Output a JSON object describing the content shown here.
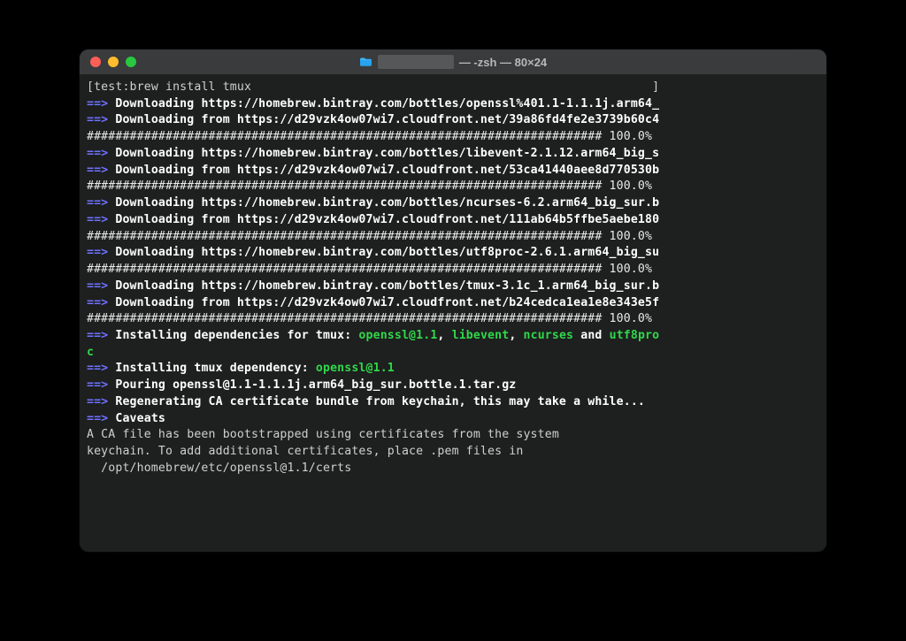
{
  "window": {
    "title_suffix": " — -zsh — 80×24",
    "folder_icon": "folder-icon"
  },
  "traffic": {
    "close": "close",
    "minimize": "minimize",
    "zoom": "zoom"
  },
  "lines": [
    {
      "t": "prompt",
      "open": "[",
      "prompt": "test:",
      "cmd": "brew install tmux",
      "close": "]"
    },
    {
      "t": "arrow_bold",
      "arrow": "==>",
      "rest": " Downloading https://homebrew.bintray.com/bottles/openssl%401.1-1.1.1j.arm64_"
    },
    {
      "t": "arrow_bold",
      "arrow": "==>",
      "rest": " Downloading from https://d29vzk4ow07wi7.cloudfront.net/39a86fd4fe2e3739b60c4"
    },
    {
      "t": "plain",
      "text": "######################################################################## 100.0%"
    },
    {
      "t": "arrow_bold",
      "arrow": "==>",
      "rest": " Downloading https://homebrew.bintray.com/bottles/libevent-2.1.12.arm64_big_s"
    },
    {
      "t": "arrow_bold",
      "arrow": "==>",
      "rest": " Downloading from https://d29vzk4ow07wi7.cloudfront.net/53ca41440aee8d770530b"
    },
    {
      "t": "plain",
      "text": "######################################################################## 100.0%"
    },
    {
      "t": "arrow_bold",
      "arrow": "==>",
      "rest": " Downloading https://homebrew.bintray.com/bottles/ncurses-6.2.arm64_big_sur.b"
    },
    {
      "t": "arrow_bold",
      "arrow": "==>",
      "rest": " Downloading from https://d29vzk4ow07wi7.cloudfront.net/111ab64b5ffbe5aebe180"
    },
    {
      "t": "plain",
      "text": "######################################################################## 100.0%"
    },
    {
      "t": "arrow_bold",
      "arrow": "==>",
      "rest": " Downloading https://homebrew.bintray.com/bottles/utf8proc-2.6.1.arm64_big_su"
    },
    {
      "t": "plain",
      "text": "######################################################################## 100.0%"
    },
    {
      "t": "arrow_bold",
      "arrow": "==>",
      "rest": " Downloading https://homebrew.bintray.com/bottles/tmux-3.1c_1.arm64_big_sur.b"
    },
    {
      "t": "arrow_bold",
      "arrow": "==>",
      "rest": " Downloading from https://d29vzk4ow07wi7.cloudfront.net/b24cedca1ea1e8e343e5f"
    },
    {
      "t": "plain",
      "text": "######################################################################## 100.0%"
    },
    {
      "t": "deps",
      "arrow": "==>",
      "pre": " Installing dependencies for tmux: ",
      "deps": [
        "openssl@1.1",
        "libevent",
        "ncurses"
      ],
      "join": ", ",
      "and": " and ",
      "wraphead": "utf8pro",
      "wraptail": "c"
    },
    {
      "t": "arrow_mix",
      "arrow": "==>",
      "bold": " Installing tmux dependency: ",
      "green": "openssl@1.1"
    },
    {
      "t": "arrow_bold",
      "arrow": "==>",
      "rest": " Pouring openssl@1.1-1.1.1j.arm64_big_sur.bottle.1.tar.gz"
    },
    {
      "t": "arrow_bold",
      "arrow": "==>",
      "rest": " Regenerating CA certificate bundle from keychain, this may take a while..."
    },
    {
      "t": "arrow_bold",
      "arrow": "==>",
      "rest": " Caveats"
    },
    {
      "t": "dim",
      "text": "A CA file has been bootstrapped using certificates from the system"
    },
    {
      "t": "dim",
      "text": "keychain. To add additional certificates, place .pem files in"
    },
    {
      "t": "dim",
      "text": "  /opt/homebrew/etc/openssl@1.1/certs"
    }
  ]
}
